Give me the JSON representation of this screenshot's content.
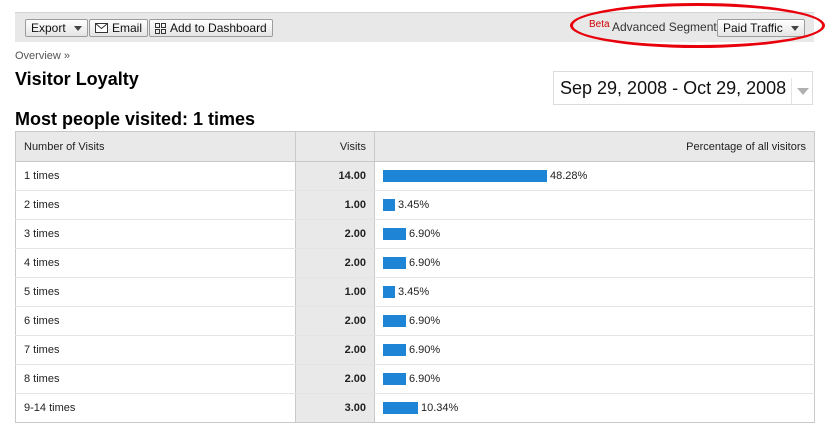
{
  "toolbar": {
    "export_label": "Export",
    "email_label": "Email",
    "dashboard_label": "Add to Dashboard",
    "beta_label": "Beta",
    "segments_label": "Advanced Segments:",
    "segment_value": "Paid Traffic"
  },
  "breadcrumb": "Overview »",
  "title": "Visitor Loyalty",
  "date_range": "Sep 29, 2008 - Oct 29, 2008",
  "headline": "Most people visited: 1 times",
  "table": {
    "columns": [
      "Number of Visits",
      "Visits",
      "Percentage of all visitors"
    ],
    "rows": [
      {
        "label": "1 times",
        "visits": "14.00",
        "pct_text": "48.28%",
        "pct": 48.28
      },
      {
        "label": "2 times",
        "visits": "1.00",
        "pct_text": "3.45%",
        "pct": 3.45
      },
      {
        "label": "3 times",
        "visits": "2.00",
        "pct_text": "6.90%",
        "pct": 6.9
      },
      {
        "label": "4 times",
        "visits": "2.00",
        "pct_text": "6.90%",
        "pct": 6.9
      },
      {
        "label": "5 times",
        "visits": "1.00",
        "pct_text": "3.45%",
        "pct": 3.45
      },
      {
        "label": "6 times",
        "visits": "2.00",
        "pct_text": "6.90%",
        "pct": 6.9
      },
      {
        "label": "7 times",
        "visits": "2.00",
        "pct_text": "6.90%",
        "pct": 6.9
      },
      {
        "label": "8 times",
        "visits": "2.00",
        "pct_text": "6.90%",
        "pct": 6.9
      },
      {
        "label": "9-14 times",
        "visits": "3.00",
        "pct_text": "10.34%",
        "pct": 10.34
      }
    ]
  },
  "colors": {
    "bar": "#1d84d6",
    "highlight": "#e8000b",
    "beta": "#d00000"
  },
  "icons": {
    "email": "envelope-icon",
    "dashboard": "grid-icon",
    "dropdown": "chevron-down-icon"
  }
}
